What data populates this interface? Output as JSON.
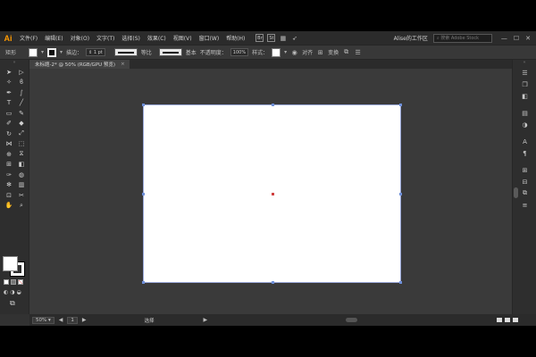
{
  "app": {
    "logo": "Ai",
    "menu": [
      "文件(F)",
      "编辑(E)",
      "对象(O)",
      "文字(T)",
      "选择(S)",
      "效果(C)",
      "视图(V)",
      "窗口(W)",
      "帮助(H)"
    ],
    "app_buttons": [
      "Br",
      "St"
    ],
    "workspace": "Alise的工作区",
    "search_placeholder": "搜索 Adobe Stock",
    "window_controls": [
      "—",
      "☐",
      "✕"
    ]
  },
  "controlbar": {
    "selection_label": "矩形",
    "stroke_label": "描边：",
    "stroke_weight": "1 pt",
    "stroke_profile": "等比",
    "brush": "基本",
    "opacity_label": "不透明度：",
    "opacity_value": "100%",
    "style_label": "样式：",
    "align_label": "对齐",
    "transform_label": "变换"
  },
  "document": {
    "tab_title": "未标题-2* @ 50% (RGB/GPU 预览)",
    "close": "×"
  },
  "toolbar": {
    "tools": [
      "select-arrow",
      "direct-select-arrow",
      "magic-wand",
      "lasso",
      "pen",
      "curvature",
      "type",
      "line",
      "rectangle",
      "paintbrush",
      "shaper",
      "eraser",
      "rotate",
      "scale",
      "width",
      "free-transform",
      "shape-builder",
      "perspective",
      "mesh",
      "gradient",
      "eyedropper",
      "blend",
      "symbol-sprayer",
      "column-graph",
      "artboard",
      "slice",
      "hand",
      "zoom"
    ]
  },
  "panels": {
    "icons": [
      "properties",
      "libraries",
      "layers",
      "color",
      "swatches",
      "brushes",
      "character",
      "paragraph",
      "transform",
      "align",
      "pathfinder",
      "stroke"
    ]
  },
  "status": {
    "zoom": "50%",
    "artboard_index": "1",
    "mode": "选择",
    "nav_prev": "◀",
    "nav_next": "▶"
  }
}
